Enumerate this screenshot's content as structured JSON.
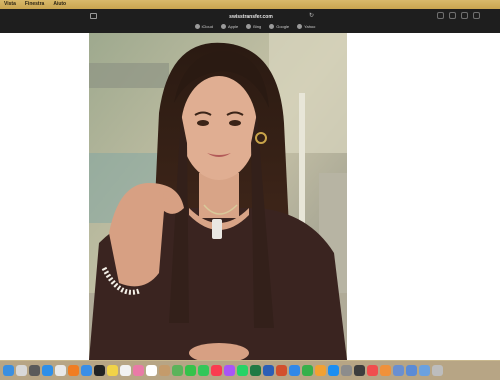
{
  "menubar": {
    "items": [
      "Vista",
      "Finestra",
      "Aiuto"
    ]
  },
  "browser": {
    "address": "swisstransfer.com",
    "favorites": [
      "iCloud",
      "Apple",
      "Bing",
      "Google",
      "Yahoo"
    ]
  },
  "dock": {
    "apps": [
      {
        "name": "finder",
        "color": "#3b8fe0"
      },
      {
        "name": "launchpad",
        "color": "#d8d8d8"
      },
      {
        "name": "system",
        "color": "#5a5a5a"
      },
      {
        "name": "safari",
        "color": "#2f8fe8"
      },
      {
        "name": "chrome",
        "color": "#e9e9e9"
      },
      {
        "name": "firefox",
        "color": "#f07d22"
      },
      {
        "name": "mail",
        "color": "#3a8ee6"
      },
      {
        "name": "terminal",
        "color": "#222222"
      },
      {
        "name": "notes",
        "color": "#f1d348"
      },
      {
        "name": "reminders",
        "color": "#f2f2f2"
      },
      {
        "name": "photos",
        "color": "#e97aa7"
      },
      {
        "name": "calendar",
        "color": "#ffffff"
      },
      {
        "name": "contacts",
        "color": "#c49b6b"
      },
      {
        "name": "maps",
        "color": "#5bb35a"
      },
      {
        "name": "facetime",
        "color": "#35c24a"
      },
      {
        "name": "messages",
        "color": "#34c759"
      },
      {
        "name": "music",
        "color": "#fa3c50"
      },
      {
        "name": "podcasts",
        "color": "#a855f7"
      },
      {
        "name": "whatsapp",
        "color": "#25d366"
      },
      {
        "name": "excel",
        "color": "#1f7a44"
      },
      {
        "name": "word",
        "color": "#2b5fb5"
      },
      {
        "name": "powerpoint",
        "color": "#d2502d"
      },
      {
        "name": "keynote",
        "color": "#2f88e8"
      },
      {
        "name": "numbers",
        "color": "#36b04a"
      },
      {
        "name": "pages",
        "color": "#f2a132"
      },
      {
        "name": "appstore",
        "color": "#1c8ef0"
      },
      {
        "name": "settings",
        "color": "#8c8c8c"
      },
      {
        "name": "calculator",
        "color": "#3d3d3d"
      },
      {
        "name": "news",
        "color": "#f04e4e"
      },
      {
        "name": "books",
        "color": "#f0913a"
      },
      {
        "name": "preview",
        "color": "#6a8fd0"
      },
      {
        "name": "downloads",
        "color": "#5b8bd6"
      },
      {
        "name": "folder",
        "color": "#6aa1e0"
      },
      {
        "name": "trash",
        "color": "#bdbdbd"
      }
    ]
  }
}
